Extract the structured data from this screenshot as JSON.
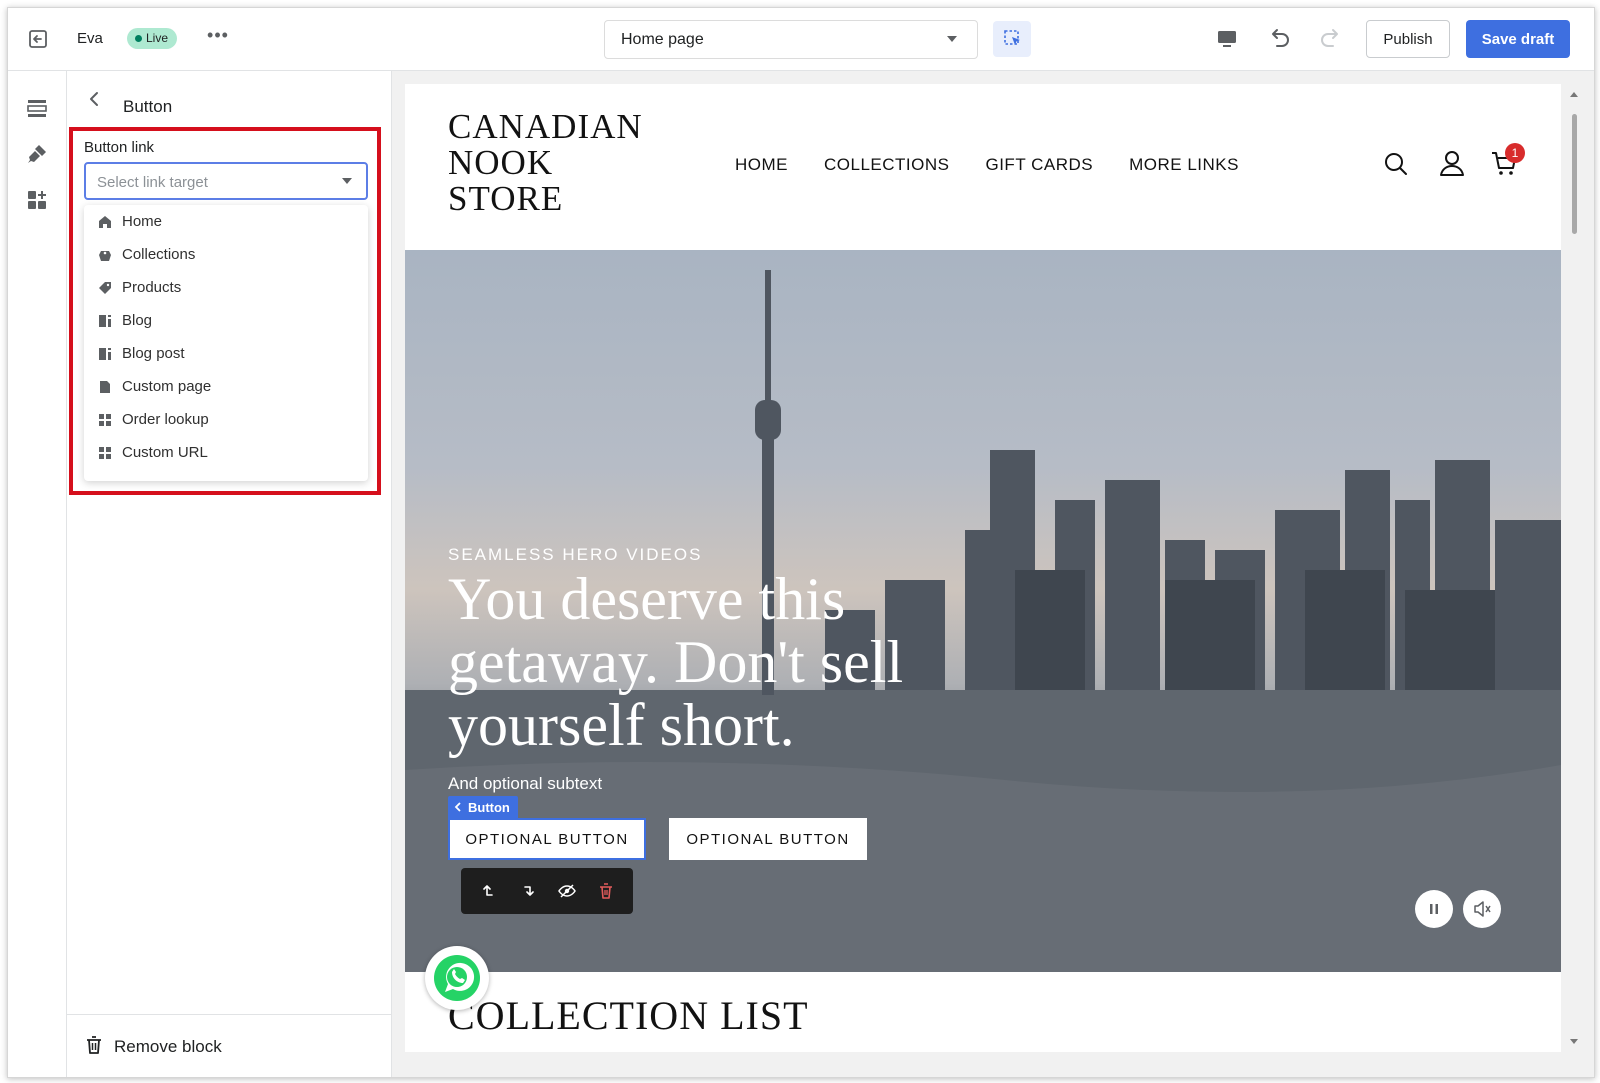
{
  "topbar": {
    "store_name": "Eva",
    "status_badge": "Live",
    "more_label": "•••",
    "page_select": "Home page",
    "publish_label": "Publish",
    "save_draft_label": "Save draft"
  },
  "sidebar": {
    "title": "Button",
    "field_label": "Button link",
    "link_placeholder": "Select link target",
    "link_options": [
      {
        "label": "Home",
        "icon": "home-icon"
      },
      {
        "label": "Collections",
        "icon": "collections-icon"
      },
      {
        "label": "Products",
        "icon": "tag-icon"
      },
      {
        "label": "Blog",
        "icon": "blog-icon"
      },
      {
        "label": "Blog post",
        "icon": "blog-post-icon"
      },
      {
        "label": "Custom page",
        "icon": "page-icon"
      },
      {
        "label": "Order lookup",
        "icon": "apps-icon"
      },
      {
        "label": "Custom URL",
        "icon": "apps-icon"
      }
    ],
    "remove_label": "Remove block"
  },
  "preview": {
    "logo_lines": [
      "CANADIAN",
      "NOOK",
      "STORE"
    ],
    "nav": [
      "HOME",
      "COLLECTIONS",
      "GIFT CARDS",
      "MORE LINKS"
    ],
    "cart_count": "1",
    "hero": {
      "eyebrow": "SEAMLESS HERO VIDEOS",
      "heading": "You deserve this getaway. Don't sell yourself short.",
      "subtext": "And optional subtext",
      "selected_tag": "Button",
      "button_1": "OPTIONAL BUTTON",
      "button_2": "OPTIONAL BUTTON"
    },
    "next_section_heading": "COLLECTION LIST"
  },
  "colors": {
    "accent": "#3e6fe0",
    "highlight": "#d50f1c",
    "live_badge": "#aee9d1",
    "cart_badge": "#d82c2c",
    "whatsapp": "#25d366"
  }
}
